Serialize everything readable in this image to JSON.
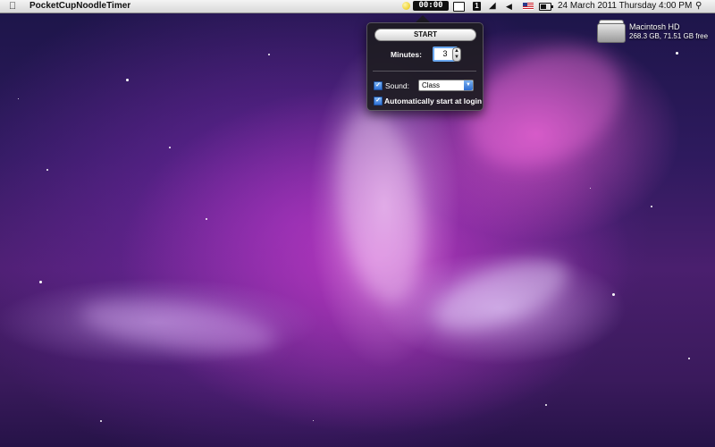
{
  "menubar": {
    "app_name": "PocketCupNoodleTimer",
    "timer_display": "00:00",
    "clock": "24 March 2011 Thursday 4:00 PM",
    "apple_icon": "apple-icon",
    "extras_icons": [
      "timer-status-icon",
      "display-icon",
      "info-icon",
      "wifi-icon",
      "volume-icon",
      "flag-icon",
      "battery-icon",
      "spotlight-icon"
    ]
  },
  "timer_panel": {
    "start_label": "START",
    "minutes_label": "Minutes:",
    "minutes_value": "3",
    "sound_label": "Sound:",
    "sound_checked": true,
    "sound_value": "Class",
    "autostart_label": "Automatically start at login",
    "autostart_checked": true
  },
  "desktop": {
    "disk_name": "Macintosh HD",
    "disk_info": "268.3 GB, 71.51 GB free"
  },
  "colors": {
    "accent": "#3a7fe0",
    "panel_bg": "#1e1c22",
    "wallpaper_magenta": "#d24ad0",
    "wallpaper_violet": "#2e1a5e"
  }
}
